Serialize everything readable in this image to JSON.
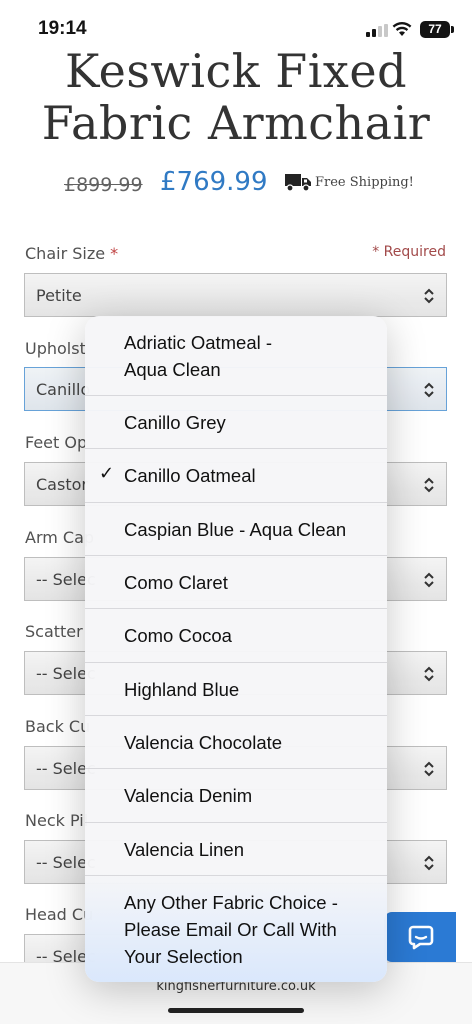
{
  "status": {
    "time": "19:14",
    "battery": "77"
  },
  "product": {
    "title_line1": "Keswick Fixed",
    "title_line2": "Fabric Armchair",
    "old_price": "£899.99",
    "new_price": "£769.99",
    "shipping": "Free Shipping!"
  },
  "form": {
    "required_note": "* Required",
    "fields": [
      {
        "label": "Chair Size",
        "value": "Petite",
        "required": "*"
      },
      {
        "label": "Upholst",
        "value": "Canillo"
      },
      {
        "label": "Feet Op",
        "value": "Castor"
      },
      {
        "label": "Arm Cap",
        "value": "-- Selec"
      },
      {
        "label": "Scatter",
        "value": "-- Selec"
      },
      {
        "label": "Back Cu",
        "value": "-- Selec"
      },
      {
        "label": "Neck Pil",
        "value": "-- Selec"
      },
      {
        "label": "Head Cu",
        "value": "-- Selec"
      }
    ]
  },
  "picker": {
    "selected": "Canillo Oatmeal",
    "options": [
      {
        "line1": "Adriatic Oatmeal -",
        "line2": "Aqua Clean"
      },
      {
        "line1": "Canillo Grey"
      },
      {
        "line1": "Canillo Oatmeal",
        "checked": true
      },
      {
        "line1": "Caspian Blue - Aqua Clean"
      },
      {
        "line1": "Como Claret"
      },
      {
        "line1": "Como Cocoa"
      },
      {
        "line1": "Highland Blue"
      },
      {
        "line1": "Valencia Chocolate"
      },
      {
        "line1": "Valencia Denim"
      },
      {
        "line1": "Valencia Linen"
      },
      {
        "line1": "Any Other Fabric Choice -",
        "line2": "Please Email Or Call With",
        "line3": "Your Selection"
      }
    ]
  },
  "footer": {
    "url": "kingfisherfurniture.co.uk"
  },
  "colors": {
    "price": "#1f6fbf",
    "chat": "#1a6fd1",
    "required": "#9b3b3b",
    "focus": "#5b9bd5"
  },
  "icons": [
    "signal-icon",
    "wifi-icon",
    "battery-icon",
    "truck-icon",
    "chevron-updown-icon",
    "checkmark-icon",
    "chat-icon"
  ]
}
